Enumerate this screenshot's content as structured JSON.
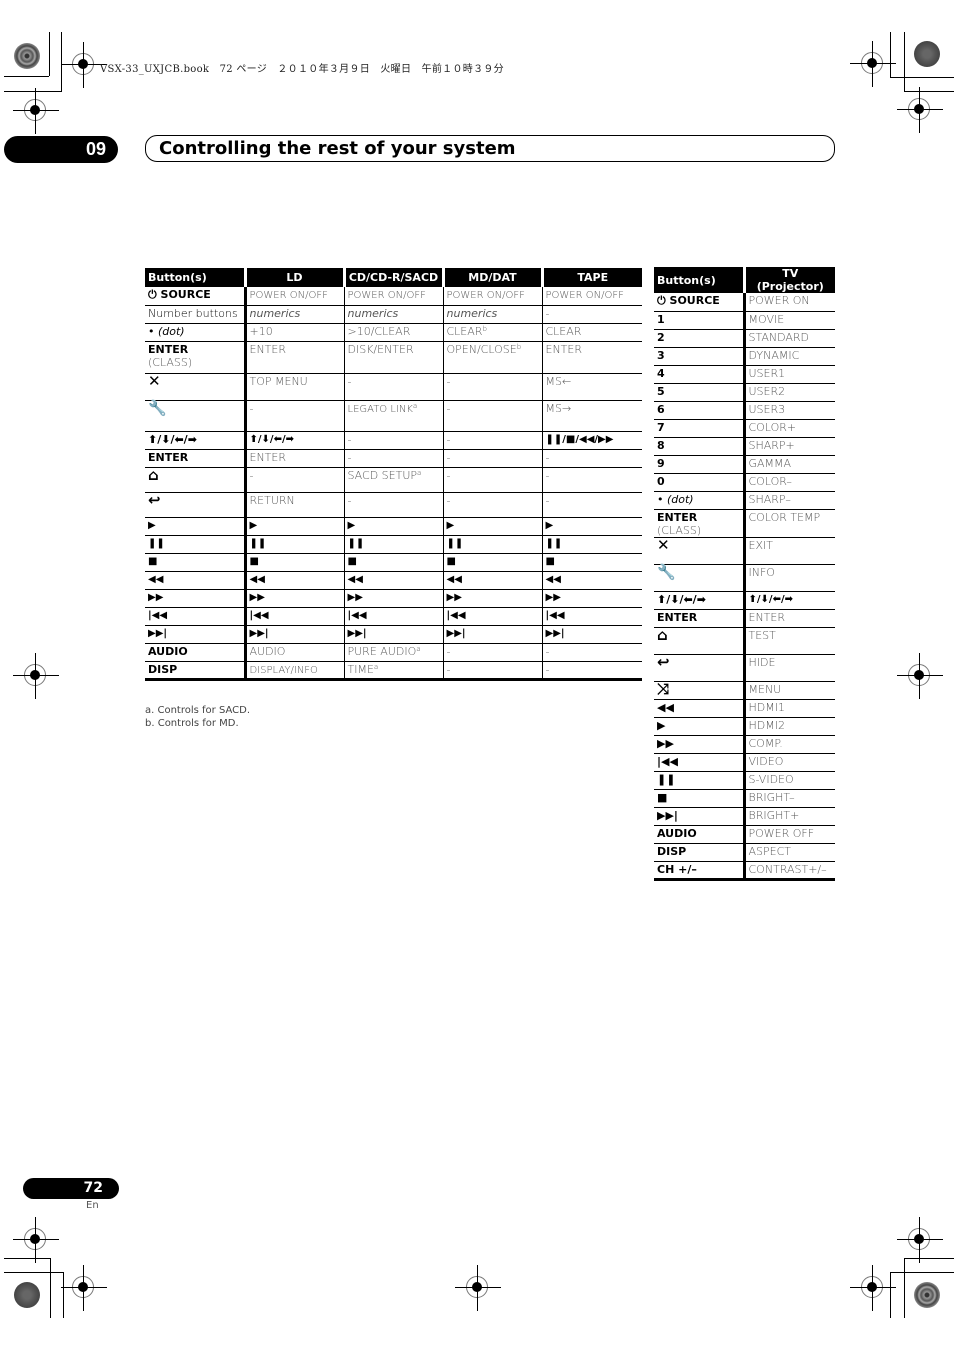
{
  "print_header": "VSX-33_UXJCB.book　72 ページ　２０１０年３月９日　火曜日　午前１０時３９分",
  "chapter": {
    "number": "09",
    "title": "Controlling the rest of your system"
  },
  "left_table": {
    "headers": [
      "Button(s)",
      "LD",
      "CD/CD-R/SACD",
      "MD/DAT",
      "TAPE"
    ],
    "rows": [
      {
        "button": "⏻ SOURCE",
        "button_bold": true,
        "cells": [
          "POWER ON/OFF",
          "POWER ON/OFF",
          "POWER ON/OFF",
          "POWER ON/OFF"
        ]
      },
      {
        "button": "Number buttons",
        "button_bold": false,
        "cells_italic": [
          true,
          true,
          true,
          false
        ],
        "cells": [
          "numerics",
          "numerics",
          "numerics",
          "-"
        ]
      },
      {
        "button": "• (dot)",
        "button_bold": false,
        "cells": [
          "+10",
          ">10/CLEAR",
          "CLEAR",
          "CLEAR"
        ],
        "sups": [
          "",
          "",
          "b",
          ""
        ]
      },
      {
        "button": "ENTER",
        "button_sub": "(CLASS)",
        "button_bold": true,
        "cells": [
          "ENTER",
          "DISK/ENTER",
          "OPEN/CLOSE",
          "ENTER"
        ],
        "sups": [
          "",
          "",
          "b",
          ""
        ]
      },
      {
        "button_icon": "close-x-icon",
        "button": "✕",
        "cells": [
          "TOP MENU",
          "-",
          "-",
          "MS←"
        ]
      },
      {
        "button_icon": "wrench-icon",
        "button": "🔧",
        "cells": [
          "-",
          "LEGATO LINK",
          "-",
          "MS→"
        ],
        "sups": [
          "",
          "a",
          "",
          ""
        ]
      },
      {
        "button": "⬆/⬇/⬅/➡",
        "button_bold": true,
        "cells": [
          "⬆/⬇/⬅/➡",
          "-",
          "-",
          "❚❚/■/◀◀/▶▶"
        ]
      },
      {
        "button": "ENTER",
        "button_bold": true,
        "cells": [
          "ENTER",
          "-",
          "-",
          "-"
        ]
      },
      {
        "button_icon": "home-icon",
        "button": "⌂",
        "cells": [
          "-",
          "SACD SETUP",
          "-",
          "-"
        ],
        "sups": [
          "",
          "a",
          "",
          ""
        ]
      },
      {
        "button_icon": "return-icon",
        "button": "↩",
        "cells": [
          "RETURN",
          "-",
          "-",
          "-"
        ]
      },
      {
        "button": "▶",
        "symbol": true,
        "cells": [
          "▶",
          "▶",
          "▶",
          "▶"
        ]
      },
      {
        "button": "❚❚",
        "symbol": true,
        "cells": [
          "❚❚",
          "❚❚",
          "❚❚",
          "❚❚"
        ]
      },
      {
        "button": "■",
        "symbol": true,
        "cells": [
          "■",
          "■",
          "■",
          "■"
        ]
      },
      {
        "button": "◀◀",
        "symbol": true,
        "cells": [
          "◀◀",
          "◀◀",
          "◀◀",
          "◀◀"
        ]
      },
      {
        "button": "▶▶",
        "symbol": true,
        "cells": [
          "▶▶",
          "▶▶",
          "▶▶",
          "▶▶"
        ]
      },
      {
        "button": "|◀◀",
        "symbol": true,
        "cells": [
          "|◀◀",
          "|◀◀",
          "|◀◀",
          "|◀◀"
        ]
      },
      {
        "button": "▶▶|",
        "symbol": true,
        "cells": [
          "▶▶|",
          "▶▶|",
          "▶▶|",
          "▶▶|"
        ]
      },
      {
        "button": "AUDIO",
        "button_bold": true,
        "cells": [
          "AUDIO",
          "PURE AUDIO",
          "-",
          "-"
        ],
        "sups": [
          "",
          "a",
          "",
          ""
        ]
      },
      {
        "button": "DISP",
        "button_bold": true,
        "cells": [
          "DISPLAY/INFO",
          "TIME",
          "-",
          "-"
        ],
        "sups": [
          "",
          "a",
          "",
          ""
        ]
      }
    ]
  },
  "footnotes": [
    "a. Controls for SACD.",
    "b. Controls for MD."
  ],
  "right_table": {
    "headers": [
      "Button(s)",
      "TV (Projector)"
    ],
    "rows": [
      {
        "button": "⏻ SOURCE",
        "value": "POWER ON"
      },
      {
        "button": "1",
        "value": "MOVIE"
      },
      {
        "button": "2",
        "value": "STANDARD"
      },
      {
        "button": "3",
        "value": "DYNAMIC"
      },
      {
        "button": "4",
        "value": "USER1"
      },
      {
        "button": "5",
        "value": "USER2"
      },
      {
        "button": "6",
        "value": "USER3"
      },
      {
        "button": "7",
        "value": "COLOR+"
      },
      {
        "button": "8",
        "value": "SHARP+"
      },
      {
        "button": "9",
        "value": "GAMMA"
      },
      {
        "button": "0",
        "value": "COLOR–"
      },
      {
        "button": "• (dot)",
        "value": "SHARP–",
        "plain": true
      },
      {
        "button": "ENTER",
        "button_sub_inline": "(CLASS)",
        "value": "COLOR TEMP"
      },
      {
        "button": "✕",
        "button_icon": "close-x-icon",
        "value": "EXIT",
        "tall": true
      },
      {
        "button": "🔧",
        "button_icon": "wrench-icon",
        "value": "INFO",
        "tall": true
      },
      {
        "button": "⬆/⬇/⬅/➡",
        "value": "⬆/⬇/⬅/➡",
        "value_bold": true
      },
      {
        "button": "ENTER",
        "value": "ENTER"
      },
      {
        "button": "⌂",
        "button_icon": "home-icon",
        "value": "TEST",
        "tall": true
      },
      {
        "button": "↩",
        "button_icon": "return-icon",
        "value": "HIDE",
        "tall": true
      },
      {
        "button": "⤨",
        "button_icon": "shuffle-icon",
        "value": "MENU"
      },
      {
        "button": "◀◀",
        "value": "HDMI1"
      },
      {
        "button": "▶",
        "value": "HDMI2"
      },
      {
        "button": "▶▶",
        "value": "COMP."
      },
      {
        "button": "|◀◀",
        "value": "VIDEO"
      },
      {
        "button": "❚❚",
        "value": "S-VIDEO"
      },
      {
        "button": "■",
        "value": "BRIGHT–"
      },
      {
        "button": "▶▶|",
        "value": "BRIGHT+"
      },
      {
        "button": "AUDIO",
        "value": "POWER OFF"
      },
      {
        "button": "DISP",
        "value": "ASPECT"
      },
      {
        "button": "CH +/–",
        "value": "CONTRAST+/–"
      }
    ]
  },
  "page": {
    "number": "72",
    "lang": "En"
  }
}
